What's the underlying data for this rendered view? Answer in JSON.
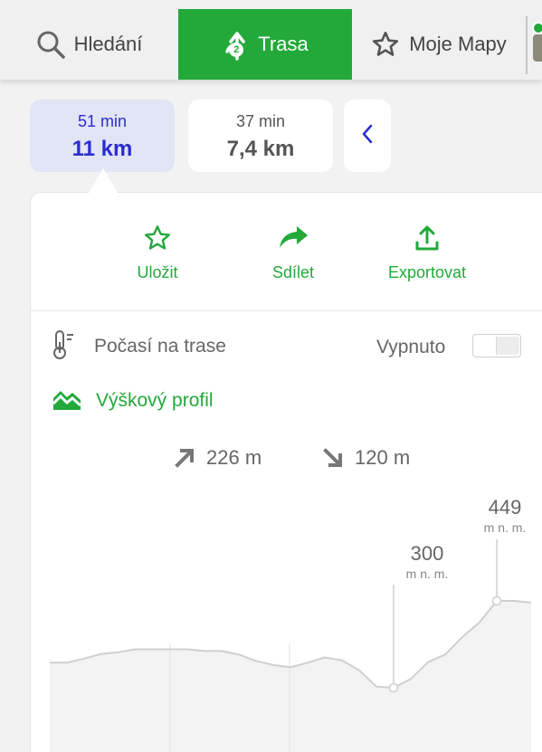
{
  "nav": {
    "search_label": "Hledání",
    "route_label": "Trasa",
    "route_badge": "2",
    "maps_label": "Moje Mapy"
  },
  "routes": [
    {
      "time": "51 min",
      "distance": "11 km",
      "selected": true
    },
    {
      "time": "37 min",
      "distance": "7,4 km",
      "selected": false
    }
  ],
  "actions": {
    "save": "Uložit",
    "share": "Sdílet",
    "export": "Exportovat"
  },
  "weather": {
    "label": "Počasí na trase",
    "state": "Vypnuto",
    "enabled": false
  },
  "profile": {
    "label": "Výškový profil",
    "ascent": "226 m",
    "descent": "120 m"
  },
  "elevation": {
    "min": {
      "value": "300",
      "unit": "m n. m."
    },
    "max": {
      "value": "449",
      "unit": "m n. m."
    },
    "profile_m": [
      343,
      343,
      350,
      358,
      361,
      366,
      366,
      366,
      366,
      363,
      363,
      357,
      346,
      339,
      335,
      343,
      352,
      347,
      330,
      302,
      300,
      315,
      344,
      357,
      387,
      412,
      449,
      449,
      446
    ]
  },
  "colors": {
    "accent_green": "#22a93a",
    "selected_blue": "#2b2cd1",
    "selected_bg": "#e1e5f6"
  }
}
